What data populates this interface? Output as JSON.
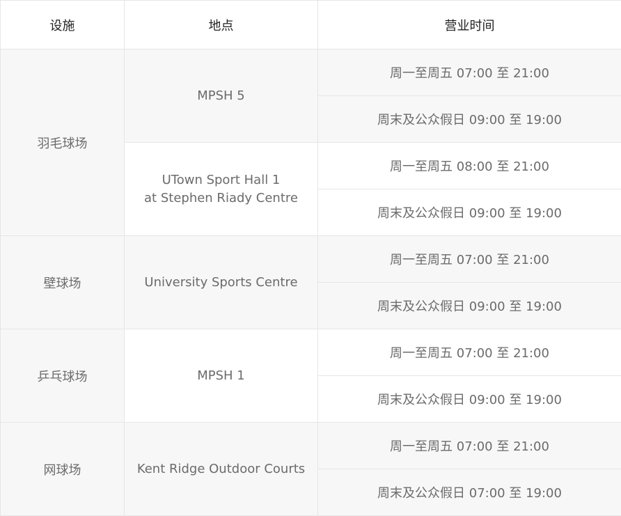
{
  "headers": [
    "设施",
    "地点",
    "营业时间"
  ],
  "facilities": [
    {
      "name": "羽毛球场",
      "locations": [
        {
          "lines": [
            "MPSH 5"
          ],
          "hours": [
            "周一至周五 07:00 至 21:00",
            "周末及公众假日 09:00 至 19:00"
          ]
        },
        {
          "lines": [
            "UTown Sport Hall 1",
            "at Stephen Riady Centre"
          ],
          "hours": [
            "周一至周五 08:00 至 21:00",
            "周末及公众假日 09:00 至 19:00"
          ]
        }
      ]
    },
    {
      "name": "壁球场",
      "locations": [
        {
          "lines": [
            "University Sports Centre"
          ],
          "hours": [
            "周一至周五 07:00 至 21:00",
            "周末及公众假日 09:00 至 19:00"
          ]
        }
      ]
    },
    {
      "name": "乒乓球场",
      "locations": [
        {
          "lines": [
            "MPSH 1"
          ],
          "hours": [
            "周一至周五 07:00 至 21:00",
            "周末及公众假日 09:00 至 19:00"
          ]
        }
      ]
    },
    {
      "name": "网球场",
      "locations": [
        {
          "lines": [
            "Kent Ridge Outdoor Courts"
          ],
          "hours": [
            "周一至周五 07:00 至 21:00",
            "周末及公众假日 07:00 至 19:00"
          ]
        }
      ]
    }
  ]
}
